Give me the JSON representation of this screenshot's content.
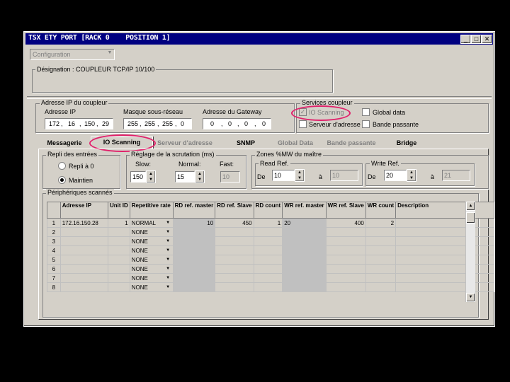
{
  "window": {
    "title": "TSX ETY PORT [RACK 0    POSITION 1]"
  },
  "config_select": "Configuration",
  "designation": {
    "label": "Désignation : COUPLEUR TCP/IP 10/100"
  },
  "ip_group": {
    "title": "Adresse IP du coupleur",
    "ip_label": "Adresse IP",
    "mask_label": "Masque sous-réseau",
    "gateway_label": "Adresse du Gateway",
    "ip": [
      "172",
      "16",
      "150",
      "29"
    ],
    "mask": [
      "255",
      "255",
      "255",
      "0"
    ],
    "gateway": [
      "0",
      "0",
      "0",
      "0"
    ]
  },
  "services": {
    "title": "Services coupleur",
    "io_scanning": "IO Scanning",
    "global_data": "Global data",
    "address_server": "Serveur d'adresse",
    "bandwidth": "Bande passante"
  },
  "tabs": [
    "Messagerie",
    "IO Scanning",
    "Serveur d'adresse",
    "SNMP",
    "Global Data",
    "Bande passante",
    "Bridge"
  ],
  "fallback": {
    "title": "Repli des entrées",
    "repli": "Repli à 0",
    "maintien": "Maintien"
  },
  "scrutation": {
    "title": "Réglage de la scrutation (ms)",
    "slow_label": "Slow:",
    "normal_label": "Normal:",
    "fast_label": "Fast:",
    "slow": "150",
    "normal": "15",
    "fast": "10"
  },
  "zones": {
    "title": "Zones %MW du maître",
    "read_title": "Read Ref.",
    "write_title": "Write Ref.",
    "de": "De",
    "a": "à",
    "read_from": "10",
    "read_to": "10",
    "write_from": "20",
    "write_to": "21"
  },
  "devices": {
    "title": "Périphériques scannés",
    "headers": [
      "",
      "Adresse IP",
      "Unit ID",
      "Repetitive rate",
      "RD ref. master",
      "RD ref. Slave",
      "RD count",
      "WR ref. master",
      "WR ref. Slave",
      "WR count",
      "Description"
    ],
    "rows": [
      [
        "1",
        "172.16.150.28",
        "1",
        "NORMAL",
        "10",
        "450",
        "1",
        "20",
        "400",
        "2",
        ""
      ],
      [
        "2",
        "",
        "",
        "NONE",
        "",
        "",
        "",
        "",
        "",
        "",
        ""
      ],
      [
        "3",
        "",
        "",
        "NONE",
        "",
        "",
        "",
        "",
        "",
        "",
        ""
      ],
      [
        "4",
        "",
        "",
        "NONE",
        "",
        "",
        "",
        "",
        "",
        "",
        ""
      ],
      [
        "5",
        "",
        "",
        "NONE",
        "",
        "",
        "",
        "",
        "",
        "",
        ""
      ],
      [
        "6",
        "",
        "",
        "NONE",
        "",
        "",
        "",
        "",
        "",
        "",
        ""
      ],
      [
        "7",
        "",
        "",
        "NONE",
        "",
        "",
        "",
        "",
        "",
        "",
        ""
      ],
      [
        "8",
        "",
        "",
        "NONE",
        "",
        "",
        "",
        "",
        "",
        "",
        ""
      ]
    ]
  },
  "colors": {
    "titlebar": "#000080",
    "highlight": "#e0206a",
    "face": "#d4d0c8"
  }
}
